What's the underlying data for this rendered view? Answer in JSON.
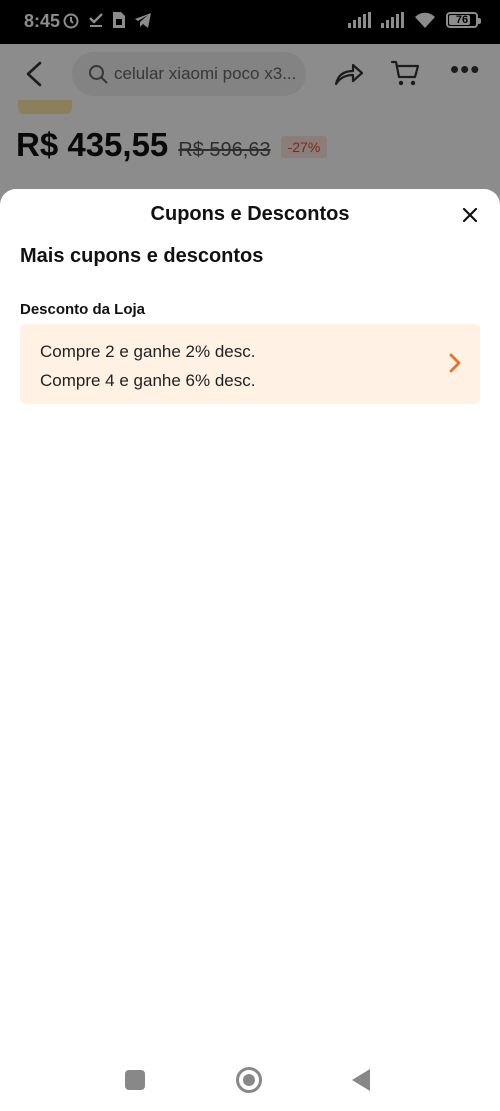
{
  "status_bar": {
    "time": "8:45",
    "battery": "76",
    "battery_level": 0.76,
    "icons": [
      "alarm-icon",
      "check-icon",
      "sim-icon",
      "telegram-icon",
      "signal-icon",
      "signal-icon",
      "wifi-icon",
      "battery-icon"
    ]
  },
  "top_nav": {
    "search_placeholder": "celular xiaomi poco x3...",
    "icons": [
      "back-arrow-icon",
      "search-icon",
      "share-icon",
      "cart-icon",
      "more-icon"
    ]
  },
  "product": {
    "price": "R$ 435,55",
    "original_price": "R$ 596,63",
    "discount": "-27%"
  },
  "sheet": {
    "title": "Cupons e Descontos",
    "section_heading": "Mais cupons e descontos",
    "store_discount_label": "Desconto da Loja",
    "store_discounts": [
      "Compre 2 e ganhe 2% desc.",
      "Compre 4 e ganhe 6% desc."
    ]
  },
  "colors": {
    "accent": "#e8722a",
    "card_background": "#fff2e5",
    "discount_badge_text": "#e64a2e",
    "overlay": "rgba(0,0,0,0.45)"
  }
}
